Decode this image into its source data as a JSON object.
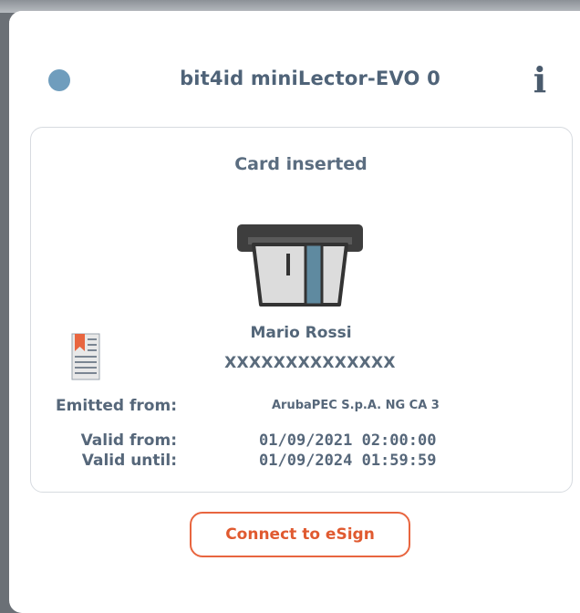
{
  "reader": {
    "name": "bit4id miniLector-EVO 0",
    "status_color": "#6f9dbd",
    "info_icon": "info-icon"
  },
  "card": {
    "status": "Card inserted",
    "holder_name": "Mario Rossi",
    "holder_id": "XXXXXXXXXXXXXX",
    "emitted_from_label": "Emitted from:",
    "emitted_from_value": "ArubaPEC S.p.A. NG CA 3",
    "valid_from_label": "Valid from:",
    "valid_from_value": "01/09/2021 02:00:00",
    "valid_until_label": "Valid until:",
    "valid_until_value": "01/09/2024 01:59:59"
  },
  "actions": {
    "connect_label": "Connect to eSign",
    "accent_color": "#e8653f"
  }
}
